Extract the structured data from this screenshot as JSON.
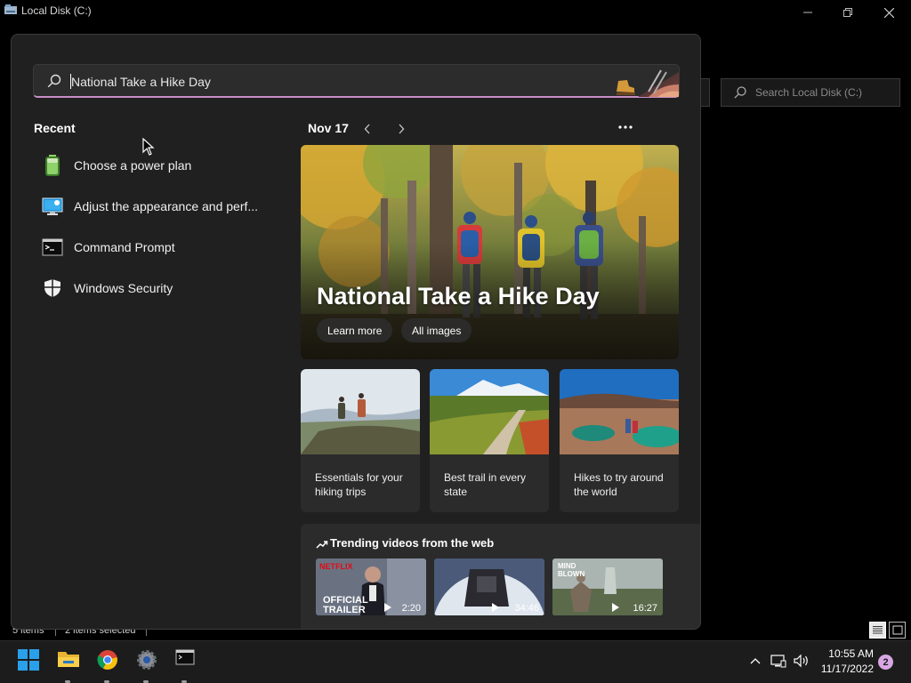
{
  "explorer": {
    "title": "Local Disk (C:)",
    "search_placeholder": "Search Local Disk (C:)",
    "status_count": "5 items",
    "status_selected": "2 items selected"
  },
  "search": {
    "query": "National Take a Hike Day",
    "accent_color": "#c98fc7"
  },
  "recent": {
    "heading": "Recent",
    "items": [
      {
        "label": "Choose a power plan",
        "icon": "battery-icon"
      },
      {
        "label": "Adjust the appearance and perf...",
        "icon": "monitor-settings-icon"
      },
      {
        "label": "Command Prompt",
        "icon": "terminal-icon"
      },
      {
        "label": "Windows Security",
        "icon": "shield-icon"
      }
    ]
  },
  "highlights": {
    "date": "Nov 17",
    "hero": {
      "title": "National Take a Hike Day",
      "learn_more": "Learn more",
      "all_images": "All images"
    },
    "cards": [
      {
        "text": "Essentials for your hiking trips"
      },
      {
        "text": "Best trail in every state"
      },
      {
        "text": "Hikes to try around the world"
      }
    ],
    "trending": {
      "title": "Trending videos from the web",
      "videos": [
        {
          "duration": "2:20",
          "overlay_badge": "NETFLIX",
          "overlay_text": "OFFICIAL TRAILER"
        },
        {
          "duration": "34:46"
        },
        {
          "duration": "16:27",
          "overlay_text": "MIND BLOWN"
        }
      ]
    }
  },
  "taskbar": {
    "apps": [
      "start",
      "file-explorer",
      "chrome",
      "settings",
      "terminal"
    ],
    "time": "10:55 AM",
    "date": "11/17/2022",
    "notifications": "2"
  }
}
